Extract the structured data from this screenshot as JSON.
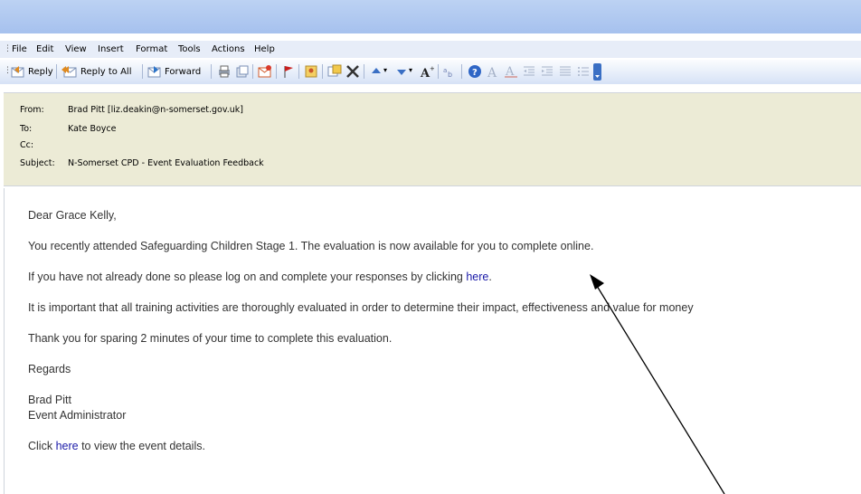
{
  "menu": {
    "items": [
      "File",
      "Edit",
      "View",
      "Insert",
      "Format",
      "Tools",
      "Actions",
      "Help"
    ]
  },
  "toolbar": {
    "reply": "Reply",
    "reply_all": "Reply to All",
    "forward": "Forward"
  },
  "header": {
    "from_label": "From:",
    "from_value": "Brad Pitt [liz.deakin@n-somerset.gov.uk]",
    "to_label": "To:",
    "to_value": "Kate Boyce",
    "cc_label": "Cc:",
    "subject_label": "Subject:",
    "subject_value": "N-Somerset CPD - Event Evaluation Feedback"
  },
  "body": {
    "greeting": "Dear Grace Kelly,",
    "line1": "You recently attended Safeguarding Children Stage 1. The evaluation is now available for you to complete online.",
    "line2_pre": "If you have not already done so please log on and complete your responses by clicking ",
    "line2_link": "here",
    "line2_post": ".",
    "line3": "It is important that all training activities are thoroughly evaluated in order to determine their impact, effectiveness and value for money",
    "line4": "Thank you for sparing 2 minutes of your time to complete this evaluation.",
    "regards": "Regards",
    "sig_name": "Brad Pitt",
    "sig_title": "Event Administrator",
    "line5_pre": "Click ",
    "line5_link": "here",
    "line5_post": " to view the event details."
  }
}
